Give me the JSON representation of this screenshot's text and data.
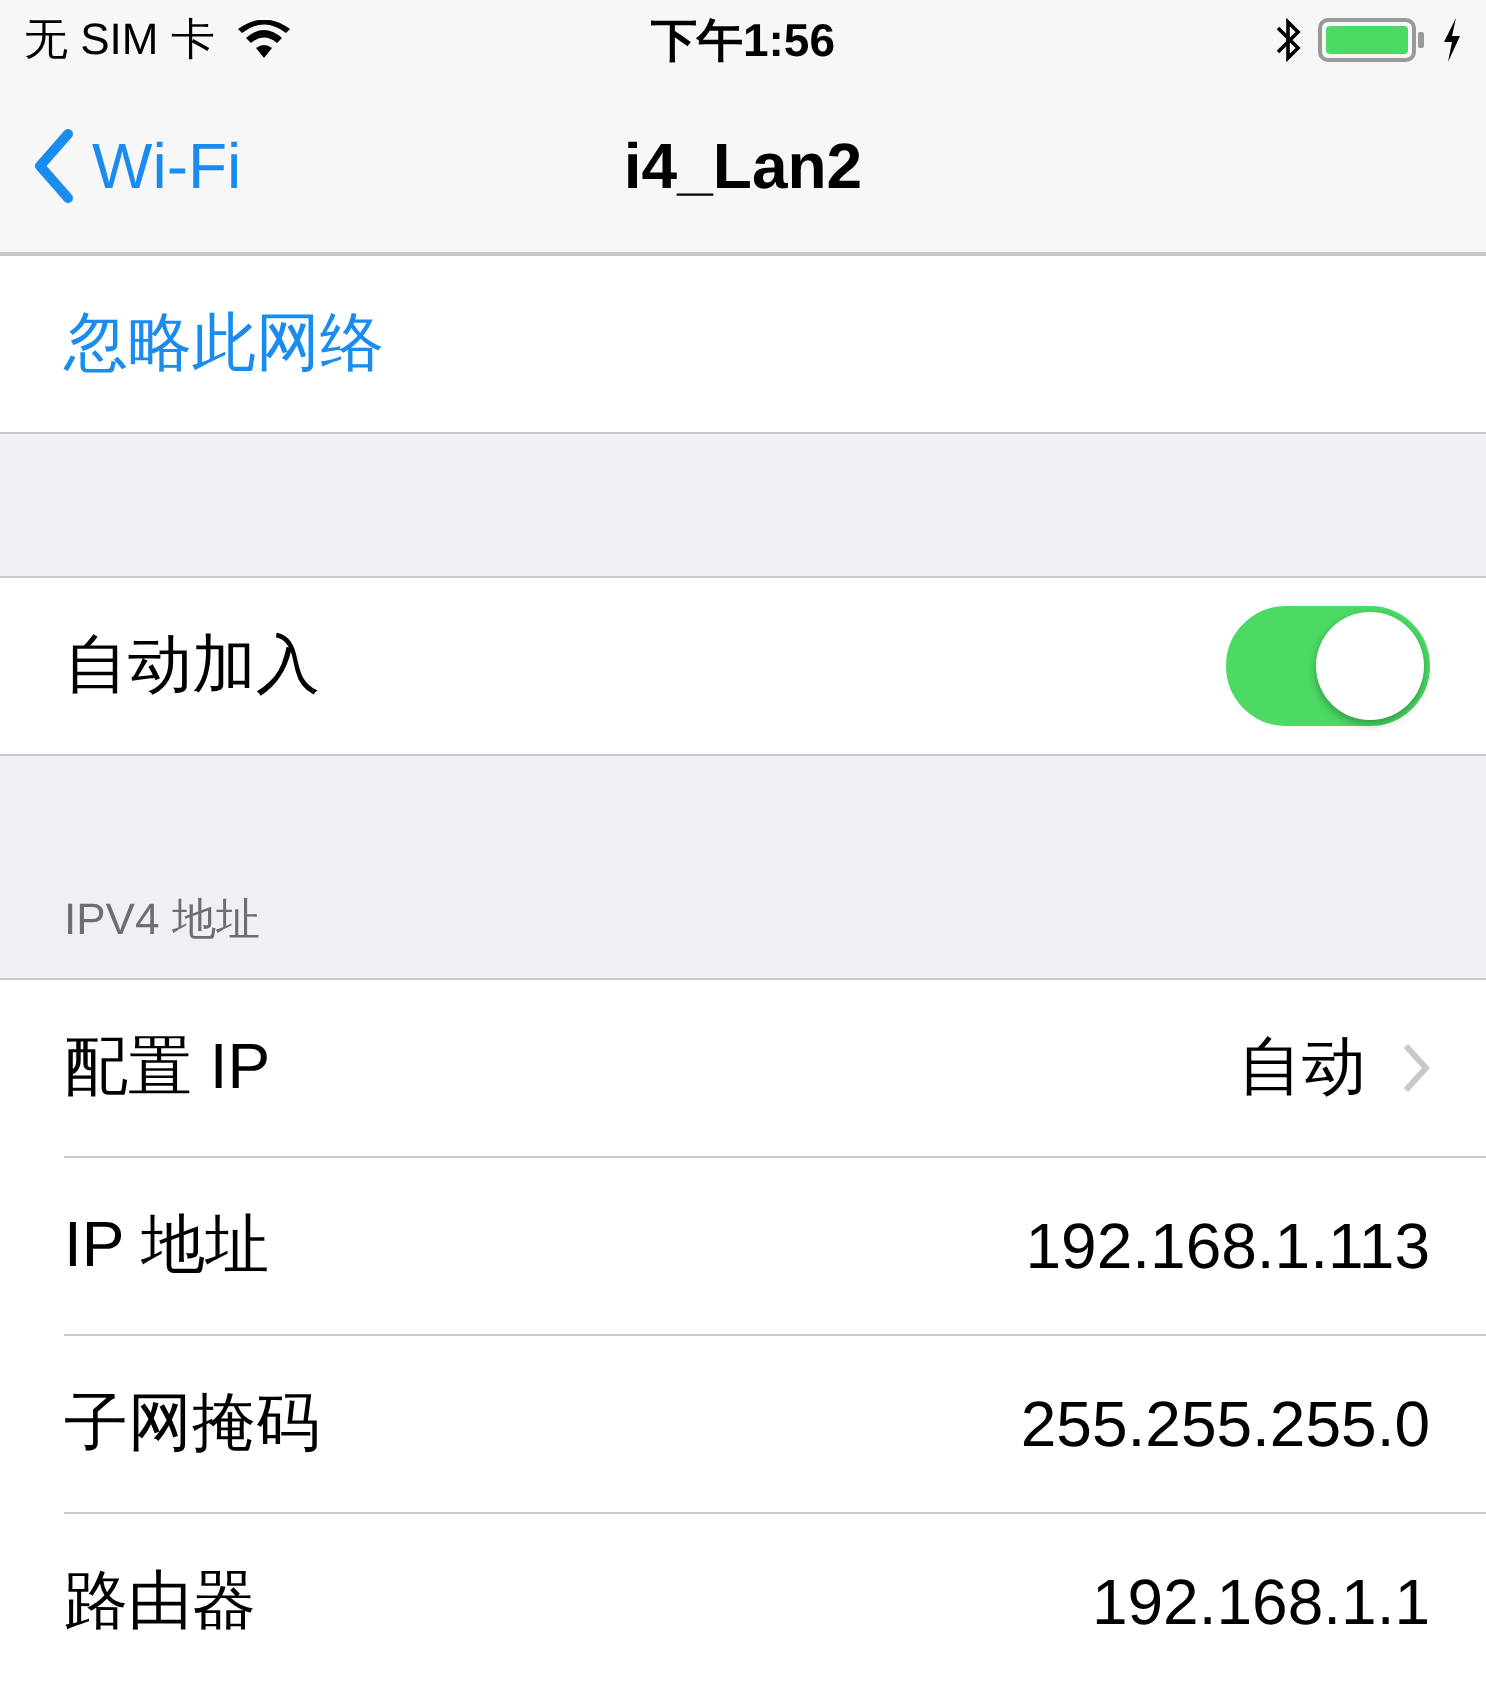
{
  "status_bar": {
    "carrier": "无 SIM 卡",
    "time": "下午1:56"
  },
  "nav": {
    "back": "Wi-Fi",
    "title": "i4_Lan2"
  },
  "forget_network": "忽略此网络",
  "auto_join": {
    "label": "自动加入",
    "on": true
  },
  "ipv4": {
    "header": "IPV4 地址",
    "rows": [
      {
        "kind": "link",
        "label": "配置 IP",
        "value": "自动"
      },
      {
        "kind": "value",
        "label": "IP 地址",
        "value": "192.168.1.113"
      },
      {
        "kind": "value",
        "label": "子网掩码",
        "value": "255.255.255.0"
      },
      {
        "kind": "value",
        "label": "路由器",
        "value": "192.168.1.1"
      }
    ]
  }
}
